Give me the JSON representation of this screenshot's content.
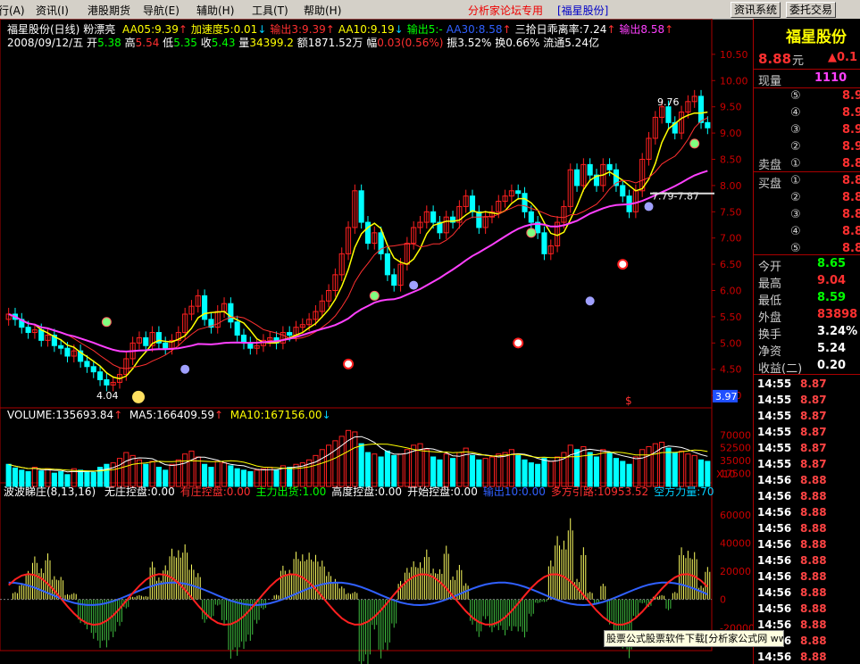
{
  "menu": {
    "items": [
      "行(A)",
      "资讯(I)",
      "港股期货",
      "导航(E)",
      "辅助(H)",
      "工具(T)",
      "帮助(H)"
    ],
    "promo": "分析家论坛专用",
    "stock_tag": "[福星股份]",
    "btn_news": "资讯系统",
    "btn_trade": "委托交易"
  },
  "header": {
    "title": "福星股份(日线)",
    "style": "粉漂亮",
    "indicators": [
      {
        "text": "AA05:9.39",
        "arrow": "↑",
        "color": "#ffff00",
        "arrow_color": "#ff3030"
      },
      {
        "text": "加速度5:0.01",
        "arrow": "↓",
        "color": "#ffff00",
        "arrow_color": "#00d0ff"
      },
      {
        "text": "输出3:9.39",
        "arrow": "↑",
        "color": "#ff3030",
        "arrow_color": "#ff3030"
      },
      {
        "text": "AA10:9.19",
        "arrow": "↓",
        "color": "#ffff00",
        "arrow_color": "#00d0ff"
      },
      {
        "text": "输出5:-",
        "arrow": "",
        "color": "#00ff00",
        "arrow_color": "#00ff00"
      },
      {
        "text": "AA30:8.58",
        "arrow": "↑",
        "color": "#3060ff",
        "arrow_color": "#ff3030"
      },
      {
        "text": "三拾日乖离率:7.24",
        "arrow": "↑",
        "color": "#ffffff",
        "arrow_color": "#ff3030"
      },
      {
        "text": "输出8.58",
        "arrow": "↑",
        "color": "#ff40ff",
        "arrow_color": "#ff3030"
      }
    ],
    "date": "2008/09/12/五",
    "open_label": "开",
    "open": "5.38",
    "high_label": "高",
    "high": "5.54",
    "low_label": "低",
    "low": "5.35",
    "close_label": "收",
    "close": "5.43",
    "vol_label": "量",
    "vol": "34399.2",
    "amt_label": "额",
    "amt": "1871.52万",
    "chg_label": "幅",
    "chg": "0.03(0.56%)",
    "amp_label": "振",
    "amp": "3.52%",
    "turn_label": "换",
    "turn": "0.66%",
    "float_label": "流通",
    "float": "5.24亿"
  },
  "price_axis": [
    "10.50",
    "10.00",
    "9.50",
    "9.00",
    "8.50",
    "8.00",
    "7.50",
    "7.00",
    "6.50",
    "6.00",
    "5.50",
    "5.00",
    "4.50",
    "4.00"
  ],
  "annotations": {
    "low_mark": "4.04",
    "high_mark": "9.76",
    "range_mark": "7.79-7.87",
    "current_marker": "3.97",
    "s_mark": "$"
  },
  "volume": {
    "label": "VOLUME:135693.84",
    "ma5": "MA5:166409.59",
    "ma10": "MA10:167156.00",
    "axis": [
      "70000",
      "52500",
      "35000",
      "17500"
    ],
    "unit": "X10"
  },
  "indicator": {
    "name": "波波睇庄(8,13,16)",
    "items": [
      {
        "text": "无庄控盘:0.00",
        "color": "#ffffff"
      },
      {
        "text": "有庄控盘:0.00",
        "color": "#ff3030"
      },
      {
        "text": "主力出货:1.00",
        "color": "#00ff00"
      },
      {
        "text": "高度控盘:0.00",
        "color": "#ffffff"
      },
      {
        "text": "开始控盘:0.00",
        "color": "#ffffff"
      },
      {
        "text": "输出10:0.00",
        "color": "#3060ff"
      },
      {
        "text": "多方引路:10953.52",
        "color": "#ff3030"
      },
      {
        "text": "空方力量:70",
        "color": "#00d0ff"
      }
    ],
    "axis": [
      "60000",
      "40000",
      "20000",
      "0",
      "-20000"
    ]
  },
  "panel": {
    "name": "福星股份",
    "price": "8.88",
    "price_unit": "元",
    "change": "▲0.1",
    "current_vol_label": "现量",
    "current_vol": "1110",
    "sell_label": "卖盘",
    "buy_label": "买盘",
    "sell_levels": [
      {
        "n": "⑤",
        "p": "8.9"
      },
      {
        "n": "④",
        "p": "8.9"
      },
      {
        "n": "③",
        "p": "8.9"
      },
      {
        "n": "②",
        "p": "8.9"
      },
      {
        "n": "①",
        "p": "8.8"
      }
    ],
    "buy_levels": [
      {
        "n": "①",
        "p": "8.8"
      },
      {
        "n": "②",
        "p": "8.8"
      },
      {
        "n": "③",
        "p": "8.8"
      },
      {
        "n": "④",
        "p": "8.8"
      },
      {
        "n": "⑤",
        "p": "8.8"
      }
    ],
    "stats": [
      {
        "l": "今开",
        "v": "8.65",
        "c": "#00ff00"
      },
      {
        "l": "最高",
        "v": "9.04",
        "c": "#ff3030"
      },
      {
        "l": "最低",
        "v": "8.59",
        "c": "#00ff00"
      },
      {
        "l": "外盘",
        "v": "83898",
        "c": "#ff3030"
      },
      {
        "l": "换手",
        "v": "3.24%",
        "c": "#ffffff"
      },
      {
        "l": "净资",
        "v": "5.24",
        "c": "#ffffff"
      },
      {
        "l": "收益(二)",
        "v": "0.20",
        "c": "#ffffff"
      }
    ],
    "ticks": [
      {
        "t": "14:55",
        "p": "8.87"
      },
      {
        "t": "14:55",
        "p": "8.87"
      },
      {
        "t": "14:55",
        "p": "8.87"
      },
      {
        "t": "14:55",
        "p": "8.87"
      },
      {
        "t": "14:55",
        "p": "8.87"
      },
      {
        "t": "14:55",
        "p": "8.87"
      },
      {
        "t": "14:56",
        "p": "8.88"
      },
      {
        "t": "14:56",
        "p": "8.88"
      },
      {
        "t": "14:56",
        "p": "8.88"
      },
      {
        "t": "14:56",
        "p": "8.88"
      },
      {
        "t": "14:56",
        "p": "8.88"
      },
      {
        "t": "14:56",
        "p": "8.88"
      },
      {
        "t": "14:56",
        "p": "8.88"
      },
      {
        "t": "14:56",
        "p": "8.88"
      },
      {
        "t": "14:56",
        "p": "8.88"
      },
      {
        "t": "14:56",
        "p": "8.88"
      },
      {
        "t": "14:56",
        "p": "8.88"
      },
      {
        "t": "14:56",
        "p": "8.88"
      }
    ]
  },
  "footer": "股票公式股票软件下载[分析家公式网 www.88gs.com]",
  "chart_data": {
    "type": "candlestick",
    "price_range": [
      3.9,
      10.6
    ],
    "closes": [
      5.55,
      5.45,
      5.3,
      5.2,
      5.25,
      5.05,
      5.15,
      4.95,
      4.9,
      4.75,
      4.85,
      4.65,
      4.55,
      4.45,
      4.3,
      4.2,
      4.25,
      4.4,
      4.7,
      5.0,
      5.1,
      4.95,
      5.2,
      5.0,
      4.9,
      5.05,
      5.2,
      5.55,
      5.7,
      5.9,
      5.45,
      5.3,
      5.6,
      5.75,
      5.4,
      5.15,
      5.0,
      4.9,
      4.95,
      5.05,
      5.1,
      5.0,
      5.2,
      5.15,
      5.3,
      5.35,
      5.45,
      5.6,
      5.8,
      6.0,
      6.3,
      6.7,
      7.2,
      7.9,
      7.3,
      6.9,
      7.1,
      6.7,
      6.3,
      6.1,
      6.5,
      6.9,
      7.2,
      7.3,
      7.5,
      7.3,
      7.1,
      7.4,
      7.3,
      7.6,
      7.8,
      7.5,
      7.2,
      7.4,
      7.5,
      7.7,
      7.8,
      7.9,
      7.85,
      7.5,
      7.3,
      7.1,
      6.7,
      6.85,
      7.3,
      7.6,
      8.3,
      8.0,
      8.4,
      8.2,
      8.0,
      8.4,
      8.3,
      8.0,
      7.8,
      7.5,
      7.9,
      8.5,
      8.9,
      9.3,
      9.5,
      9.2,
      9.0,
      9.4,
      9.6,
      9.7,
      9.2,
      9.1
    ],
    "volume": [
      30000,
      25000,
      22000,
      20000,
      26000,
      21000,
      24000,
      18000,
      20000,
      16000,
      24000,
      22000,
      20000,
      19000,
      26000,
      30000,
      32000,
      38000,
      46000,
      42000,
      36000,
      30000,
      34000,
      26000,
      22000,
      30000,
      36000,
      44000,
      48000,
      40000,
      30000,
      26000,
      34000,
      32000,
      28000,
      24000,
      22000,
      20000,
      22000,
      24000,
      26000,
      22000,
      28000,
      26000,
      30000,
      32000,
      36000,
      42000,
      50000,
      56000,
      62000,
      68000,
      76000,
      74000,
      58000,
      46000,
      44000,
      40000,
      48000,
      42000,
      44000,
      50000,
      56000,
      58000,
      50000,
      40000,
      36000,
      44000,
      38000,
      46000,
      52000,
      42000,
      36000,
      38000,
      40000,
      44000,
      46000,
      50000,
      42000,
      36000,
      32000,
      30000,
      38000,
      34000,
      40000,
      46000,
      56000,
      50000,
      54000,
      46000,
      40000,
      50000,
      46000,
      38000,
      34000,
      30000,
      40000,
      50000,
      54000,
      58000,
      60000,
      52000,
      46000,
      48000,
      44000,
      42000,
      36000,
      34000
    ],
    "vol_axis": [
      17500,
      35000,
      52500,
      70000
    ],
    "ind_range": [
      -35000,
      70000
    ]
  }
}
